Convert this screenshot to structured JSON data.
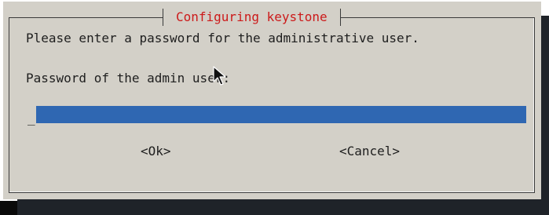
{
  "dialog": {
    "title": "Configuring keystone",
    "prompt": "Please enter a password for the administrative user.",
    "field_label": "Password of the admin user:",
    "cursor": "_",
    "password_value": "",
    "buttons": {
      "ok_label": "<Ok>",
      "cancel_label": "<Cancel>"
    }
  },
  "colors": {
    "dialog_bg": "#d3d0c8",
    "title_text": "#cc1a1a",
    "input_bg": "#2f67b2",
    "terminal_bg": "#0a0a0a"
  },
  "icons": {
    "pointer": "mouse-pointer-icon"
  }
}
